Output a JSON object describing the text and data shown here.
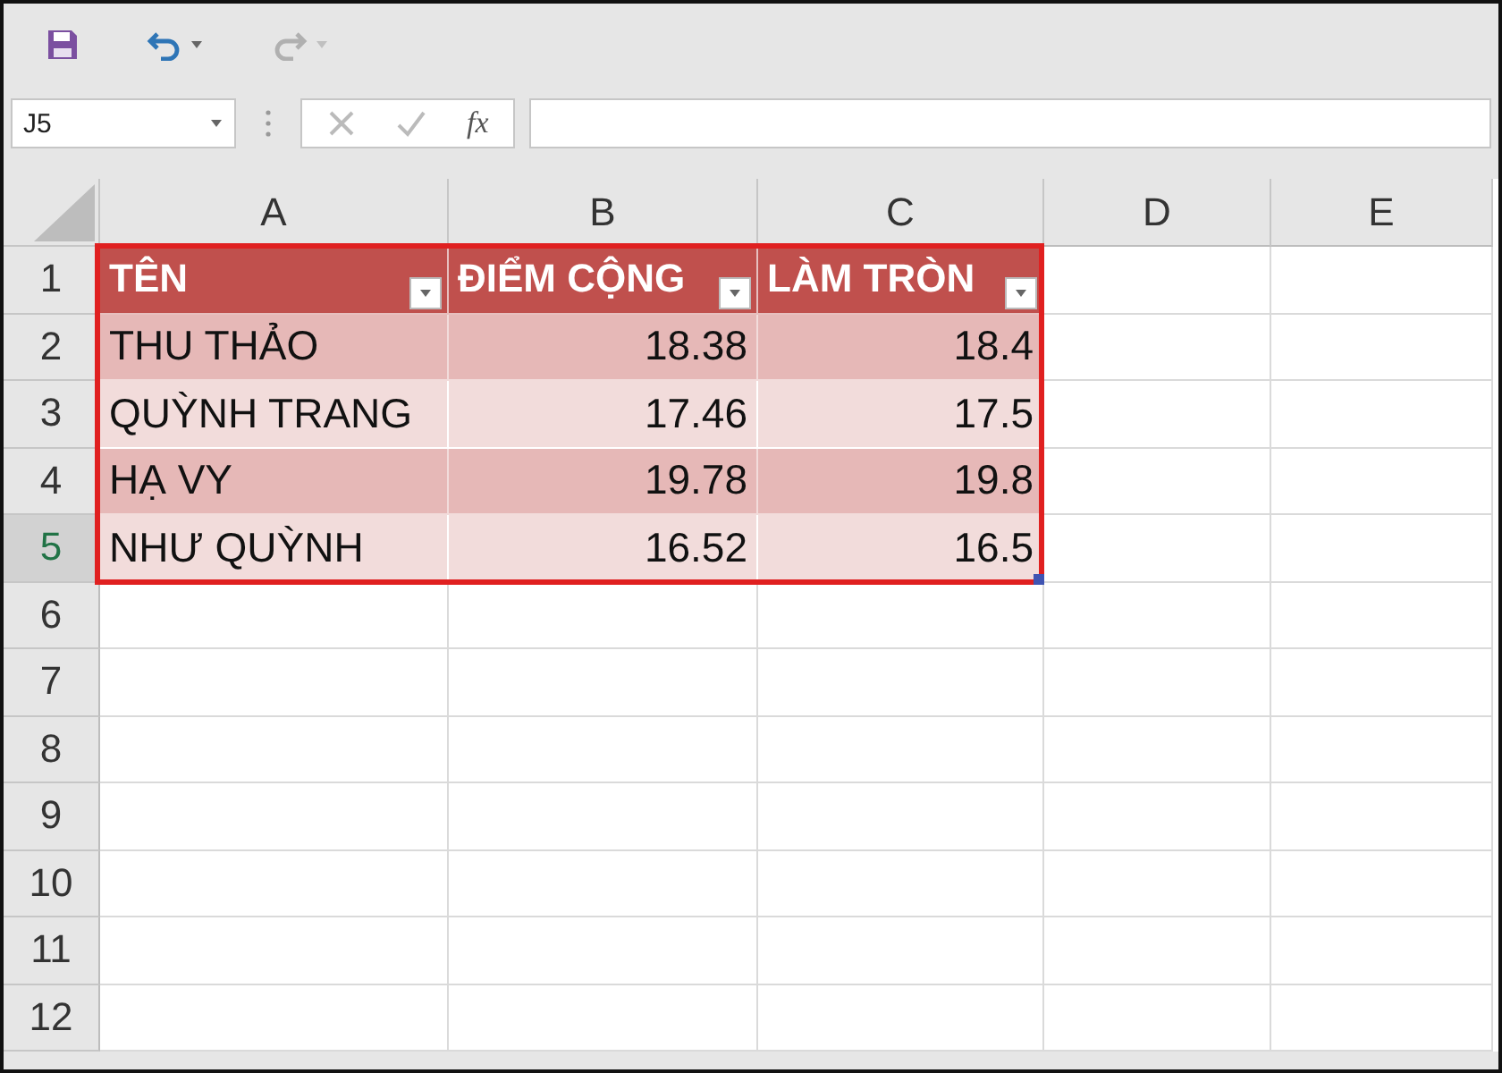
{
  "toolbar": [
    {
      "kind": "save",
      "disabled": false
    },
    {
      "kind": "undo",
      "disabled": false
    },
    {
      "kind": "redo",
      "disabled": true
    }
  ],
  "name_box": {
    "value": "J5"
  },
  "formula_bar": {
    "function_label": "fx"
  },
  "columns": [
    {
      "label": "A"
    },
    {
      "label": "B"
    },
    {
      "label": "C"
    },
    {
      "label": "D"
    },
    {
      "label": "E"
    }
  ],
  "rows": [
    {
      "label": "1",
      "selected": false
    },
    {
      "label": "2",
      "selected": false
    },
    {
      "label": "3",
      "selected": false
    },
    {
      "label": "4",
      "selected": false
    },
    {
      "label": "5",
      "selected": true
    },
    {
      "label": "6",
      "selected": false
    },
    {
      "label": "7",
      "selected": false
    },
    {
      "label": "8",
      "selected": false
    },
    {
      "label": "9",
      "selected": false
    },
    {
      "label": "10",
      "selected": false
    },
    {
      "label": "11",
      "selected": false
    },
    {
      "label": "12",
      "selected": false
    }
  ],
  "table": {
    "headers": [
      "TÊN",
      "ĐIỂM CỘNG",
      "LÀM TRÒN"
    ],
    "rows": [
      [
        "THU THẢO",
        "18.38",
        "18.4"
      ],
      [
        "QUỲNH TRANG",
        "17.46",
        "17.5"
      ],
      [
        "HẠ VY",
        "19.78",
        "19.8"
      ],
      [
        "NHƯ QUỲNH",
        "16.52",
        "16.5"
      ]
    ]
  }
}
